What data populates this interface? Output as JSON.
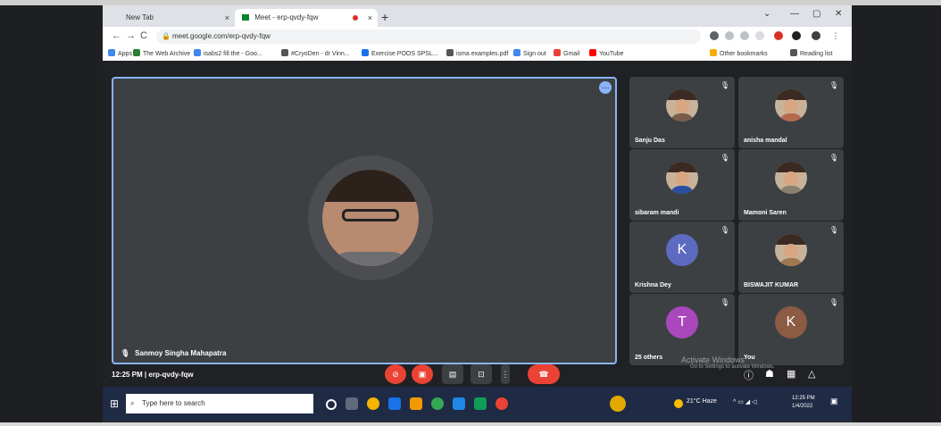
{
  "browser": {
    "tabs": [
      {
        "label": "New Tab"
      },
      {
        "label": "Meet - erp-qvdy-fqw"
      }
    ],
    "url": "meet.google.com/erp-qvdy-fqw",
    "bookmarks": [
      {
        "label": "Apps",
        "color": "#4285f4"
      },
      {
        "label": "The Web Archive",
        "color": "#2e7d32"
      },
      {
        "label": "isabs2 fill the - Goo...",
        "color": "#4285f4"
      },
      {
        "label": "#CryoDen - dr Vinn...",
        "color": "#555"
      },
      {
        "label": "Exercise POOS SPSL...",
        "color": "#1a73e8"
      },
      {
        "label": "isma examples.pdf",
        "color": "#555"
      },
      {
        "label": "Sign out",
        "color": "#4285f4"
      },
      {
        "label": "Gmail",
        "color": "#ea4335"
      },
      {
        "label": "YouTube",
        "color": "#ff0000"
      },
      {
        "label": "Other bookmarks",
        "color": "#f9ab00"
      },
      {
        "label": "Reading list",
        "color": "#555"
      }
    ]
  },
  "meet": {
    "main_speaker": "Sanmoy Singha Mahapatra",
    "participants": [
      {
        "name": "Sanju Das",
        "avatar": "photo",
        "color": "#7a5c4a"
      },
      {
        "name": "anisha mandal",
        "avatar": "photo",
        "color": "#b46a4d"
      },
      {
        "name": "sibaram mandi",
        "avatar": "photo",
        "color": "#2b4fa0"
      },
      {
        "name": "Mamoni Saren",
        "avatar": "photo",
        "color": "#8c8070"
      },
      {
        "name": "Krishna Dey",
        "avatar": "letter",
        "letter": "K",
        "color": "#5c6bc0"
      },
      {
        "name": "BISWAJIT KUMAR",
        "avatar": "photo",
        "color": "#a07850"
      },
      {
        "name": "25 others",
        "avatar": "letter",
        "letter": "T",
        "color": "#ab47bc"
      },
      {
        "name": "You",
        "avatar": "letter",
        "letter": "K",
        "color": "#8d5a44"
      }
    ],
    "time": "12:25 PM",
    "meeting_code": "erp-qvdy-fqw",
    "watermark_line1": "Activate Windows",
    "watermark_line2": "Go to Settings to activate Windows."
  },
  "taskbar": {
    "search_placeholder": "Type here to search",
    "weather": "21°C Haze",
    "clock_time": "12:25 PM",
    "clock_date": "1/4/2022"
  }
}
